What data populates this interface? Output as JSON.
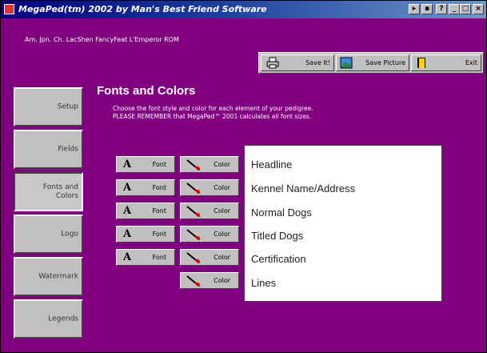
{
  "window": {
    "title": "MegaPed(tm) 2002 by Man's Best Friend Software",
    "controls": [
      "?",
      "_",
      "□",
      "×"
    ]
  },
  "subject_line": "Am. Jpn. Ch. LacShen FancyFeat L'Emperor ROM",
  "toolbar": {
    "save_label": "Save It!",
    "save_picture_label": "Save Picture",
    "exit_label": "Exit"
  },
  "sidebar": {
    "items": [
      {
        "label": "Setup"
      },
      {
        "label": "Fields"
      },
      {
        "label": "Fonts and Colors",
        "active": true
      },
      {
        "label": "Logo"
      },
      {
        "label": "Watermark"
      },
      {
        "label": "Legends"
      }
    ]
  },
  "panel": {
    "heading": "Fonts and Colors",
    "instruction_1": "Choose the font style and color for each element of your pedigree.",
    "instruction_2": "PLEASE REMEMBER that MegaPed™ 2001 calculates all font sizes."
  },
  "buttons": {
    "font_label": "Font",
    "color_label": "Color"
  },
  "preview": {
    "items": [
      "Headline",
      "Kennel Name/Address",
      "Normal Dogs",
      "Titled Dogs",
      "Certification",
      "Lines"
    ]
  },
  "colors": {
    "background": "#800080",
    "face": "#c0c0c0",
    "titlebar": "#000080"
  }
}
